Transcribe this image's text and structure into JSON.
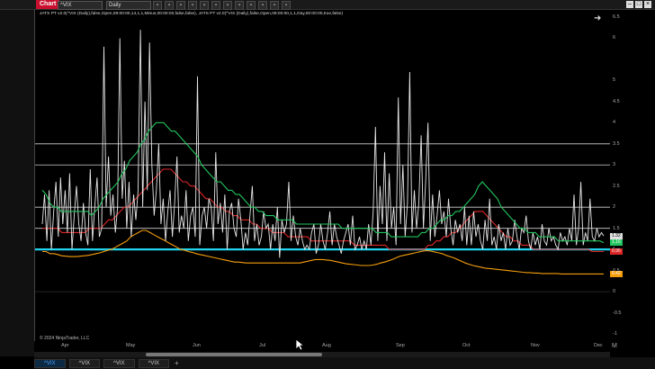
{
  "titlebar": {
    "chart_tab": "Chart",
    "instrument": "^VIX",
    "period": "Daily",
    "toolbar_icons": [
      "bars-icon",
      "crosshair-icon",
      "zoom-icon",
      "draw-icon",
      "indicator-icon",
      "strategy-icon",
      "properties-icon",
      "template-icon",
      "lock-icon",
      "snapshot-icon",
      "share-icon",
      "data-box-icon"
    ],
    "window_controls": [
      "minimize",
      "maximize",
      "close"
    ]
  },
  "indicator_label": "JATS PT v2.0(^VIX (Daily),false,Open,09:00:00,14,1,1,Minus,00:00:00,false,false), JATS PT v2.0(^VIX (Daily),false,Open,09:00:00,1,1,Day,00:00:00,true,false)",
  "yaxis": {
    "top_label": "F",
    "ticks": [
      "6.5",
      "6",
      "5",
      "4.5",
      "4",
      "3.5",
      "3",
      "2.5",
      "2",
      "1.5",
      "1",
      "0.5",
      "0",
      "-0.5",
      "-1"
    ],
    "badges": [
      {
        "value": "1.32",
        "color": "#e0e0e0"
      },
      {
        "value": "1.16",
        "color": "#22c55e"
      },
      {
        "value": "0.95",
        "color": "#dc2626"
      },
      {
        "value": "0.42",
        "color": "#f59e0b"
      }
    ]
  },
  "xaxis": {
    "ticks": [
      "Apr",
      "May",
      "Jun",
      "Jul",
      "Aug",
      "Sep",
      "Oct",
      "Nov",
      "Dec"
    ],
    "right_label": "M"
  },
  "copyright": "© 2024 NinjaTrader, LLC",
  "tabs": [
    "^VIX",
    "^VIX",
    "^VIX",
    "^VIX"
  ],
  "add_tab": "+",
  "colors": {
    "white_series": "#e6e6e6",
    "green_series": "#22c55e",
    "red_series": "#dc2626",
    "orange_series": "#f59e0b",
    "cyan_line": "#22d3ee",
    "grid": "#cfcfcf"
  },
  "chart_data": {
    "type": "line",
    "ylim": [
      -1,
      6.5
    ],
    "hlines": [
      1,
      1.5,
      2,
      3,
      3.5
    ],
    "series": [
      {
        "values": [
          1.6,
          2.3,
          1.2,
          2.4,
          1.0,
          1.9,
          2.6,
          1.3,
          2.7,
          1.6,
          2.4,
          1.4,
          2.8,
          1.0,
          1.8,
          2.5,
          1.6,
          1.2,
          2.1,
          1.4,
          1.1,
          2.9,
          1.2,
          2.0,
          2.7,
          1.3,
          1.5,
          5.8,
          2.0,
          3.2,
          1.8,
          2.3,
          1.4,
          2.0,
          6.0,
          2.2,
          3.1,
          1.5,
          2.6,
          1.3,
          2.3,
          1.7,
          2.4,
          6.2,
          2.0,
          4.5,
          2.4,
          5.9,
          3.0,
          1.8,
          2.4,
          3.5,
          1.6,
          2.2,
          1.2,
          1.9,
          2.4,
          1.3,
          2.1,
          3.2,
          1.4,
          1.8,
          1.5,
          2.4,
          1.2,
          1.8,
          2.0,
          1.3,
          5.1,
          1.1,
          1.8,
          2.0,
          1.5,
          2.2,
          2.0,
          1.2,
          3.3,
          1.6,
          2.1,
          1.4,
          2.3,
          1.0,
          1.9,
          2.1,
          1.5,
          1.3,
          2.2,
          1.7,
          1.0,
          1.4,
          1.1,
          1.8,
          2.5,
          1.2,
          1.6,
          1.1,
          1.3,
          1.9,
          1.5,
          1.6,
          1.0,
          1.6,
          1.2,
          2.0,
          0.8,
          1.7,
          1.4,
          1.6,
          2.6,
          1.2,
          1.8,
          1.3,
          1.1,
          1.5,
          1.2,
          1.0,
          1.1,
          1.0,
          1.4,
          1.6,
          0.9,
          1.1,
          1.6,
          1.2,
          1.0,
          1.4,
          1.9,
          1.1,
          1.6,
          1.3,
          1.1,
          0.9,
          1.2,
          1.4,
          1.6,
          1.1,
          1.8,
          1.0,
          1.1,
          1.3,
          1.0,
          1.2,
          1.0,
          1.6,
          1.1,
          1.9,
          3.9,
          1.2,
          2.5,
          1.6,
          3.3,
          1.2,
          2.8,
          1.5,
          2.0,
          1.1,
          4.6,
          1.6,
          3.0,
          1.3,
          2.1,
          5.2,
          1.4,
          2.4,
          1.5,
          2.1,
          3.7,
          1.5,
          2.6,
          4.0,
          1.2,
          2.3,
          1.3,
          1.8,
          2.4,
          1.6,
          1.9,
          1.3,
          2.2,
          1.5,
          1.1,
          1.7,
          1.4,
          1.6,
          1.2,
          2.0,
          1.1,
          1.8,
          1.1,
          1.9,
          1.3,
          1.6,
          1.2,
          1.0,
          1.7,
          1.2,
          2.2,
          1.1,
          1.3,
          1.0,
          1.6,
          1.2,
          1.4,
          1.0,
          1.5,
          1.1,
          1.2,
          1.7,
          1.3,
          1.0,
          1.5,
          1.4,
          1.8,
          1.2,
          1.0,
          1.4,
          1.1,
          1.3,
          1.0,
          1.6,
          1.2,
          1.1,
          1.5,
          1.2,
          1.3,
          1.1,
          1.0,
          1.4,
          1.2,
          1.3,
          1.1,
          1.5,
          1.2,
          2.3,
          1.1,
          1.5,
          2.6,
          1.1,
          1.4,
          1.2,
          2.2,
          1.3,
          1.2,
          1.5,
          1.3,
          1.4,
          1.32
        ]
      },
      {
        "values": [
          2.4,
          2.3,
          2.1,
          2.0,
          2.0,
          1.9,
          1.9,
          1.9,
          1.9,
          1.9,
          1.9,
          1.9,
          1.9,
          1.8,
          1.9,
          2.0,
          2.2,
          2.3,
          2.4,
          2.5,
          2.6,
          2.8,
          2.9,
          3.1,
          3.2,
          3.3,
          3.5,
          3.6,
          3.8,
          3.9,
          4.0,
          4.0,
          4.0,
          3.9,
          3.8,
          3.8,
          3.7,
          3.6,
          3.5,
          3.4,
          3.3,
          3.2,
          3.0,
          2.9,
          2.8,
          2.7,
          2.6,
          2.6,
          2.5,
          2.4,
          2.4,
          2.3,
          2.3,
          2.2,
          2.1,
          2.0,
          2.0,
          1.9,
          1.9,
          1.8,
          1.8,
          1.8,
          1.7,
          1.7,
          1.7,
          1.7,
          1.7,
          1.6,
          1.6,
          1.6,
          1.6,
          1.6,
          1.6,
          1.6,
          1.6,
          1.6,
          1.6,
          1.6,
          1.6,
          1.5,
          1.5,
          1.5,
          1.5,
          1.5,
          1.5,
          1.5,
          1.5,
          1.5,
          1.4,
          1.4,
          1.4,
          1.4,
          1.3,
          1.3,
          1.3,
          1.3,
          1.3,
          1.3,
          1.3,
          1.3,
          1.4,
          1.4,
          1.5,
          1.5,
          1.6,
          1.7,
          1.7,
          1.8,
          1.8,
          1.9,
          1.9,
          2.0,
          2.1,
          2.2,
          2.3,
          2.5,
          2.6,
          2.5,
          2.4,
          2.3,
          2.2,
          2.0,
          1.9,
          1.8,
          1.7,
          1.6,
          1.5,
          1.5,
          1.4,
          1.4,
          1.4,
          1.3,
          1.3,
          1.3,
          1.3,
          1.3,
          1.2,
          1.2,
          1.2,
          1.2,
          1.2,
          1.2,
          1.2,
          1.2,
          1.2,
          1.2,
          1.2,
          1.2,
          1.16
        ]
      },
      {
        "values": [
          1.5,
          1.5,
          1.5,
          1.5,
          1.5,
          1.4,
          1.4,
          1.4,
          1.4,
          1.4,
          1.4,
          1.4,
          1.5,
          1.5,
          1.5,
          1.5,
          1.6,
          1.7,
          1.7,
          1.8,
          1.9,
          2.0,
          2.0,
          2.1,
          2.2,
          2.3,
          2.4,
          2.5,
          2.6,
          2.7,
          2.8,
          2.9,
          2.9,
          2.9,
          2.8,
          2.7,
          2.6,
          2.6,
          2.5,
          2.5,
          2.4,
          2.3,
          2.2,
          2.2,
          2.1,
          2.0,
          2.0,
          1.9,
          1.9,
          1.8,
          1.8,
          1.7,
          1.7,
          1.7,
          1.6,
          1.6,
          1.5,
          1.5,
          1.5,
          1.4,
          1.4,
          1.4,
          1.4,
          1.3,
          1.3,
          1.3,
          1.3,
          1.3,
          1.3,
          1.2,
          1.2,
          1.2,
          1.2,
          1.2,
          1.2,
          1.2,
          1.2,
          1.2,
          1.2,
          1.2,
          1.1,
          1.1,
          1.1,
          1.1,
          1.1,
          1.1,
          1.1,
          1.1,
          1.1,
          1.0,
          1.0,
          1.0,
          1.0,
          1.0,
          1.0,
          1.0,
          1.0,
          1.0,
          1.0,
          1.1,
          1.1,
          1.2,
          1.2,
          1.3,
          1.3,
          1.4,
          1.4,
          1.5,
          1.6,
          1.7,
          1.8,
          1.9,
          1.9,
          1.9,
          1.8,
          1.7,
          1.6,
          1.5,
          1.4,
          1.3,
          1.3,
          1.2,
          1.2,
          1.1,
          1.1,
          1.1,
          1.0,
          1.0,
          1.0,
          1.0,
          1.0,
          1.0,
          1.0,
          1.0,
          1.0,
          1.0,
          1.0,
          1.0,
          1.0,
          1.0,
          1.0,
          0.95,
          0.95,
          0.95,
          0.95
        ]
      },
      {
        "values": [
          0.95,
          0.95,
          0.9,
          0.9,
          0.88,
          0.85,
          0.84,
          0.83,
          0.83,
          0.83,
          0.84,
          0.85,
          0.86,
          0.88,
          0.9,
          0.92,
          0.95,
          0.98,
          1.0,
          1.05,
          1.1,
          1.15,
          1.2,
          1.3,
          1.35,
          1.4,
          1.45,
          1.45,
          1.4,
          1.35,
          1.3,
          1.25,
          1.2,
          1.15,
          1.1,
          1.05,
          1.0,
          0.98,
          0.95,
          0.93,
          0.9,
          0.88,
          0.86,
          0.84,
          0.82,
          0.8,
          0.78,
          0.76,
          0.74,
          0.72,
          0.7,
          0.7,
          0.69,
          0.68,
          0.68,
          0.68,
          0.68,
          0.68,
          0.68,
          0.68,
          0.68,
          0.68,
          0.68,
          0.68,
          0.68,
          0.68,
          0.68,
          0.68,
          0.7,
          0.72,
          0.74,
          0.76,
          0.76,
          0.76,
          0.75,
          0.74,
          0.72,
          0.7,
          0.68,
          0.66,
          0.65,
          0.64,
          0.63,
          0.62,
          0.62,
          0.62,
          0.63,
          0.65,
          0.68,
          0.7,
          0.73,
          0.76,
          0.8,
          0.84,
          0.86,
          0.88,
          0.9,
          0.92,
          0.94,
          0.96,
          0.97,
          0.96,
          0.94,
          0.92,
          0.9,
          0.86,
          0.83,
          0.8,
          0.76,
          0.72,
          0.68,
          0.65,
          0.62,
          0.6,
          0.58,
          0.56,
          0.55,
          0.54,
          0.53,
          0.52,
          0.51,
          0.5,
          0.49,
          0.48,
          0.47,
          0.46,
          0.45,
          0.45,
          0.44,
          0.44,
          0.43,
          0.43,
          0.43,
          0.43,
          0.43,
          0.42,
          0.42,
          0.42,
          0.42,
          0.42,
          0.42,
          0.42,
          0.42,
          0.42,
          0.42,
          0.42,
          0.42
        ]
      }
    ]
  }
}
